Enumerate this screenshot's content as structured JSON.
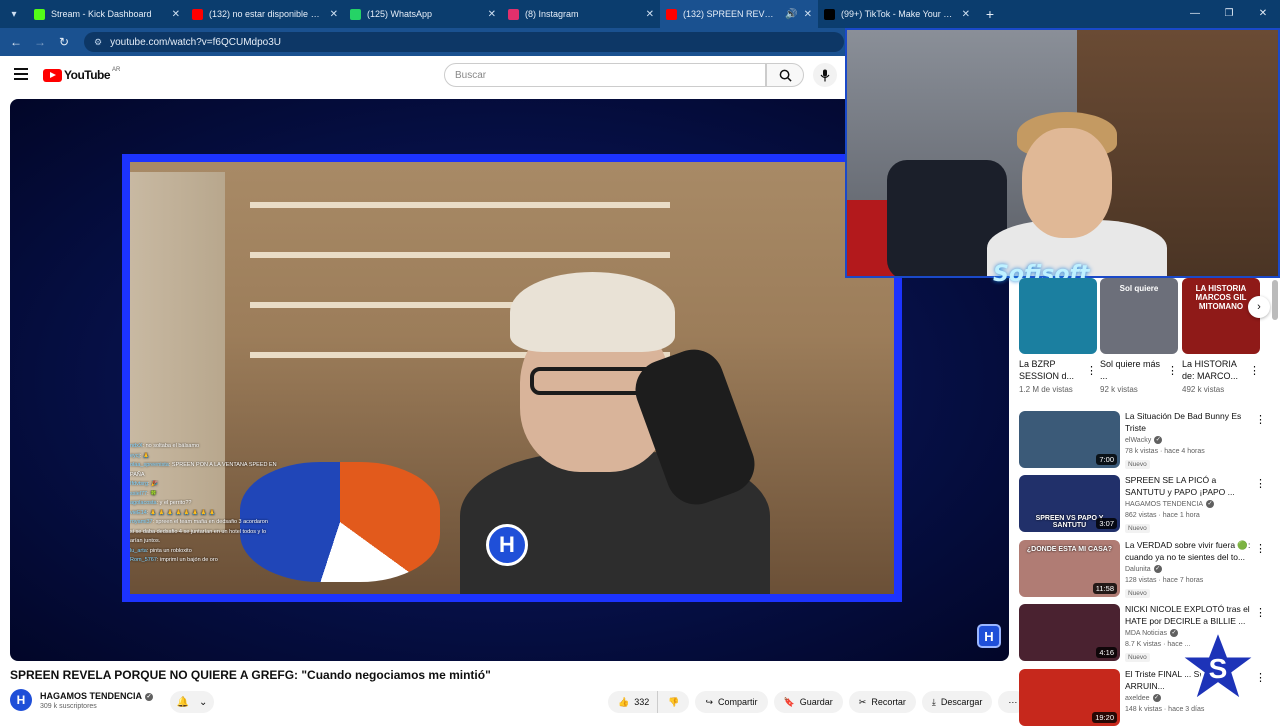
{
  "browser": {
    "tabs": [
      {
        "title": "Stream - Kick Dashboard",
        "favicon": "kick-icon",
        "color": "#53fc18",
        "active": false
      },
      {
        "title": "(132) no estar disponible para u",
        "favicon": "youtube-icon",
        "color": "#ff0000",
        "active": false
      },
      {
        "title": "(125) WhatsApp",
        "favicon": "whatsapp-icon",
        "color": "#25d366",
        "active": false
      },
      {
        "title": "(8) Instagram",
        "favicon": "instagram-icon",
        "color": "#e1306c",
        "active": false
      },
      {
        "title": "(132) SPREEN REVELA PORQ",
        "favicon": "youtube-icon",
        "color": "#ff0000",
        "active": true
      },
      {
        "title": "(99+) TikTok - Make Your Day",
        "favicon": "tiktok-icon",
        "color": "#000000",
        "active": false
      }
    ],
    "url": "youtube.com/watch?v=f6QCUMdpo3U"
  },
  "youtube": {
    "logo_text": "YouTube",
    "region": "AR",
    "search_placeholder": "Buscar"
  },
  "video": {
    "title": "SPREEN REVELA PORQUE NO QUIERE A GREFG: \"Cuando negociamos me mintió\"",
    "channel": "HAGAMOS TENDENCIA",
    "subscribers": "309 k suscriptores",
    "likes": "332",
    "actions": {
      "share": "Compartir",
      "save": "Guardar",
      "clip": "Recortar",
      "download": "Descargar"
    },
    "overlay_logo": "H",
    "chat": [
      {
        "user": "ndxX",
        "text": ": no soltaba el bálsamo"
      },
      {
        "user": "eycj",
        "text": ": 🙏"
      },
      {
        "user": "olaa_spreenista",
        "text": ": SPREEN PON A LA VENTANA SPEED EN"
      },
      {
        "user": "",
        "text": "PAÑA"
      },
      {
        "user": "Ifdvtsrg",
        "text": ": 🎉"
      },
      {
        "user": "ssiel77",
        "text": ": 🍀"
      },
      {
        "user": "agolacosta",
        "text": ": y el perrito??"
      },
      {
        "user": "vieE14",
        "text": ": 🙏 🙏 🙏 🙏 🙏 🙏 🙏 🙏"
      },
      {
        "user": "royami37",
        "text": ": spreen el team mafia en dedsafio 3 acordaron"
      },
      {
        "user": "",
        "text": "si se daba dedsafio 4 se juntarían en un hotel todos y lo"
      },
      {
        "user": "",
        "text": "arían juntos."
      },
      {
        "user": "lu_arta",
        "text": ": pinta un robloxito"
      },
      {
        "user": "Rom_5767",
        "text": ": imprimí un bajón de oro"
      }
    ]
  },
  "facecam": {
    "signature": "Sofisoft"
  },
  "shorts": [
    {
      "title": "La BZRP SESSION d...",
      "views": "1.2 M de vistas",
      "thumb": "#1b7fa0"
    },
    {
      "title": "Sol quiere más ...",
      "views": "92 k vistas",
      "thumb": "#6c6f7a"
    },
    {
      "title": "La HISTORIA de: MARCO...",
      "views": "492 k vistas",
      "thumb": "#8f1a18"
    }
  ],
  "short_thumb_texts": [
    "",
    "Sol quiere",
    "LA HISTORIA MARCOS GIL MITOMANO"
  ],
  "recommended": [
    {
      "title": "La Situación De Bad Bunny Es Triste",
      "channel": "elWacky",
      "meta": "78 k vistas · hace 4 horas",
      "badge": "Nuevo",
      "duration": "7:00",
      "thumb": "#3b5a78"
    },
    {
      "title": "SPREEN SE LA PICÓ a SANTUTU y PAPO ¡PAPO ...",
      "channel": "HAGAMOS TENDENCIA",
      "meta": "862 vistas · hace 1 hora",
      "badge": "Nuevo",
      "duration": "3:07",
      "thumb": "#21306a",
      "thumb_text": "SPREEN VS PAPO Y SANTUTU"
    },
    {
      "title": "La VERDAD sobre vivir fuera 🟢: cuando ya no te sientes del to...",
      "channel": "Dalunita",
      "meta": "128 vistas · hace 7 horas",
      "badge": "Nuevo",
      "duration": "11:58",
      "thumb": "#b07c74",
      "thumb_text": "¿DONDE ESTA MI CASA?"
    },
    {
      "title": "NICKI NICOLE EXPLOTÓ tras el HATE por DECIRLE a BILLIE ...",
      "channel": "MDA Noticias",
      "meta": "8.7 K vistas · hace ...",
      "badge": "Nuevo",
      "duration": "4:16",
      "thumb": "#4a2230"
    },
    {
      "title": "El Triste FINAL ... Streamer ARRUIN...",
      "channel": "axeldee",
      "meta": "148 k vistas · hace 3 días",
      "badge": "",
      "duration": "19:20",
      "thumb": "#c6281c"
    }
  ]
}
